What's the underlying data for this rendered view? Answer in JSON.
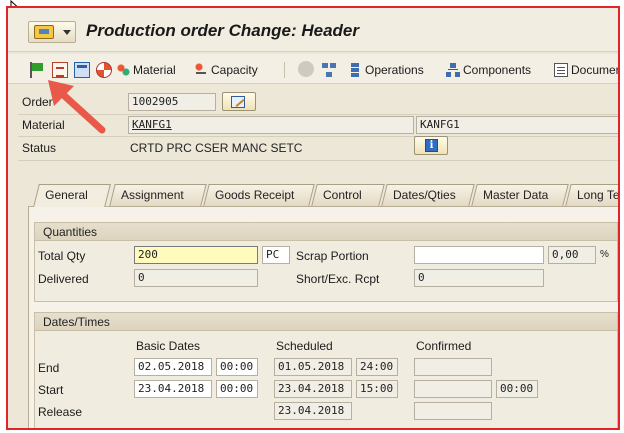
{
  "window": {
    "title": "Production order Change: Header"
  },
  "toolbar": {
    "material_label": "Material",
    "capacity_label": "Capacity",
    "operations_label": "Operations",
    "components_label": "Components",
    "documents_label": "Documen"
  },
  "header": {
    "order_label": "Order",
    "order_value": "1002905",
    "material_label": "Material",
    "material_value": "KANFG1",
    "material_desc": "KANFG1",
    "status_label": "Status",
    "status_value": "CRTD PRC  CSER MANC SETC"
  },
  "tabs": [
    {
      "label": "General"
    },
    {
      "label": "Assignment"
    },
    {
      "label": "Goods Receipt"
    },
    {
      "label": "Control"
    },
    {
      "label": "Dates/Qties"
    },
    {
      "label": "Master Data"
    },
    {
      "label": "Long Te"
    }
  ],
  "quantities": {
    "title": "Quantities",
    "total_qty_label": "Total Qty",
    "total_qty_value": "200",
    "unit": "PC",
    "scrap_label": "Scrap Portion",
    "scrap_value": "",
    "scrap_pct": "0,00",
    "pct_sign": "%",
    "delivered_label": "Delivered",
    "delivered_value": "0",
    "short_label": "Short/Exc. Rcpt",
    "short_value": "0"
  },
  "dates": {
    "title": "Dates/Times",
    "col_basic": "Basic Dates",
    "col_scheduled": "Scheduled",
    "col_confirmed": "Confirmed",
    "end_label": "End",
    "end_basic_date": "02.05.2018",
    "end_basic_time": "00:00",
    "end_sched_date": "01.05.2018",
    "end_sched_time": "24:00",
    "start_label": "Start",
    "start_basic_date": "23.04.2018",
    "start_basic_time": "00:00",
    "start_sched_date": "23.04.2018",
    "start_sched_time": "15:00",
    "start_conf_time": "00:00",
    "release_label": "Release",
    "release_sched_date": "23.04.2018"
  },
  "colors": {
    "highlight_border": "#e0242a",
    "annotation_arrow": "#e8594a"
  }
}
